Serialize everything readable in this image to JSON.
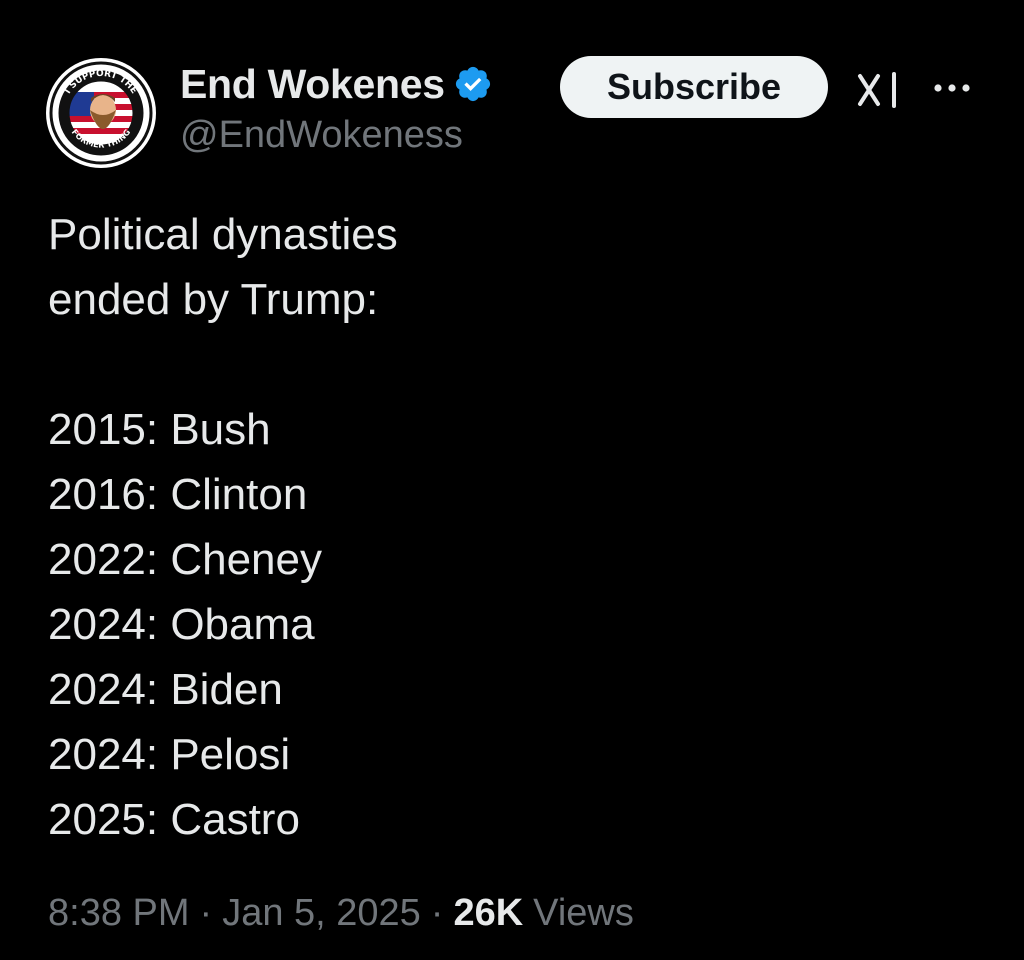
{
  "header": {
    "display_name": "End Wokenes",
    "handle": "@EndWokeness",
    "subscribe_label": "Subscribe",
    "avatar": {
      "ring_top_text": "I SUPPORT THE",
      "ring_bottom_text": "FORMER THING"
    }
  },
  "tweet": {
    "lines": [
      "Political dynasties",
      "ended by Trump:",
      "",
      "2015: Bush",
      "2016: Clinton",
      "2022: Cheney",
      "2024: Obama",
      "2024: Biden",
      "2024: Pelosi",
      "2025: Castro"
    ]
  },
  "meta": {
    "time": "8:38 PM",
    "separator": "·",
    "date": "Jan 5, 2025",
    "views_count": "26K",
    "views_label": "Views"
  },
  "icons": {
    "verified": "verified-badge-icon",
    "grok": "grok-icon",
    "more": "more-options-icon"
  },
  "colors": {
    "background": "#000000",
    "primary_text": "#e7e9ea",
    "secondary_text": "#71767b",
    "verified_blue": "#1d9bf0",
    "button_bg": "#eff3f4",
    "button_text": "#0f1419"
  }
}
